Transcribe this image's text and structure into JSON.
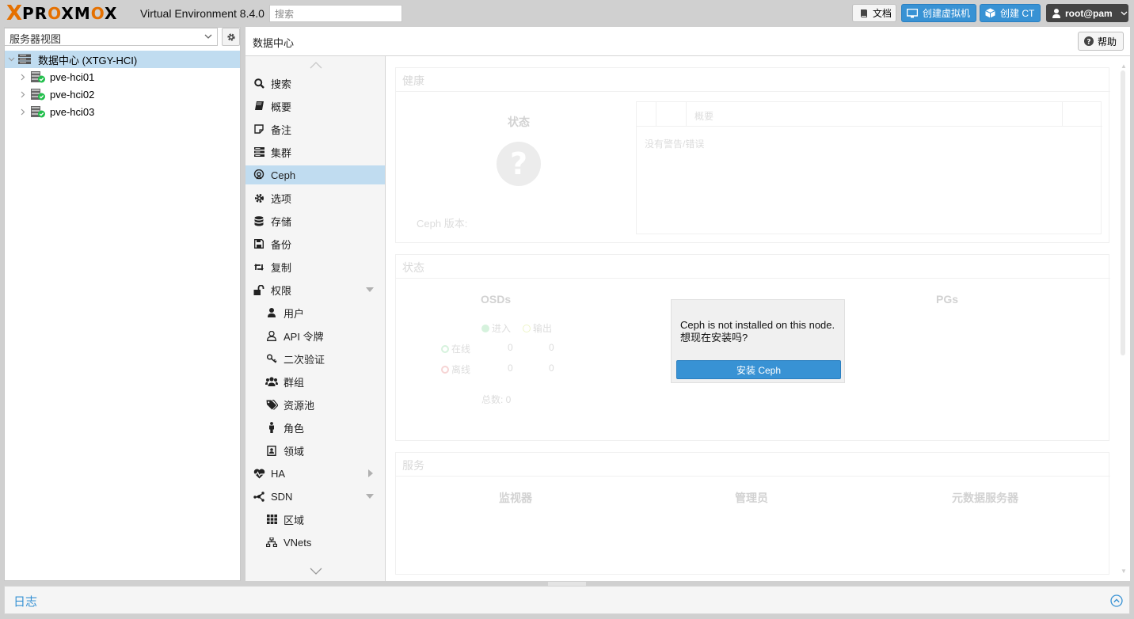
{
  "header": {
    "brand_x": "X",
    "brand_word_1": "PR",
    "brand_o1": "O",
    "brand_word_2": "XM",
    "brand_o2": "O",
    "brand_word_3": "X",
    "version": "Virtual Environment 8.4.0",
    "search_placeholder": "搜索",
    "docs_label": "文档",
    "create_vm_label": "创建虚拟机",
    "create_ct_label": "创建 CT",
    "user_label": "root@pam"
  },
  "tree": {
    "view_selector": "服务器视图",
    "datacenter": "数据中心 (XTGY-HCI)",
    "nodes": [
      "pve-hci01",
      "pve-hci02",
      "pve-hci03"
    ]
  },
  "main": {
    "breadcrumb": "数据中心",
    "help_label": "帮助"
  },
  "nav": {
    "items": [
      {
        "label": "搜索",
        "icon": "search-icon"
      },
      {
        "label": "概要",
        "icon": "book-icon"
      },
      {
        "label": "备注",
        "icon": "note-icon"
      },
      {
        "label": "集群",
        "icon": "server-icon"
      },
      {
        "label": "Ceph",
        "icon": "ceph-icon"
      },
      {
        "label": "选项",
        "icon": "gear-icon"
      },
      {
        "label": "存储",
        "icon": "database-icon"
      },
      {
        "label": "备份",
        "icon": "floppy-icon"
      },
      {
        "label": "复制",
        "icon": "retweet-icon"
      },
      {
        "label": "权限",
        "icon": "unlock-icon"
      },
      {
        "label": "用户",
        "icon": "user-icon"
      },
      {
        "label": "API 令牌",
        "icon": "user-outline-icon"
      },
      {
        "label": "二次验证",
        "icon": "key-icon"
      },
      {
        "label": "群组",
        "icon": "users-icon"
      },
      {
        "label": "资源池",
        "icon": "tags-icon"
      },
      {
        "label": "角色",
        "icon": "male-icon"
      },
      {
        "label": "领域",
        "icon": "address-book-icon"
      },
      {
        "label": "HA",
        "icon": "heartbeat-icon"
      },
      {
        "label": "SDN",
        "icon": "sdn-icon"
      },
      {
        "label": "区域",
        "icon": "th-icon"
      },
      {
        "label": "VNets",
        "icon": "sitemap-icon"
      }
    ]
  },
  "ceph": {
    "health_title": "健康",
    "status_label": "状态",
    "version_label": "Ceph 版本:",
    "summary_col": "概要",
    "no_warnings": "没有警告/错误",
    "status_title": "状态",
    "osds_label": "OSDs",
    "in_label": "进入",
    "out_label": "输出",
    "up_label": "在线",
    "down_label": "离线",
    "up_in": "0",
    "up_out": "0",
    "down_in": "0",
    "down_out": "0",
    "total_label": "总数: 0",
    "pgs_label": "PGs",
    "services_title": "服务",
    "monitors_label": "监视器",
    "managers_label": "管理员",
    "mds_label": "元数据服务器"
  },
  "modal": {
    "line1": "Ceph is not installed on this node.",
    "line2": "想现在安装吗?",
    "install_button": "安装 Ceph"
  },
  "log": {
    "title": "日志"
  }
}
